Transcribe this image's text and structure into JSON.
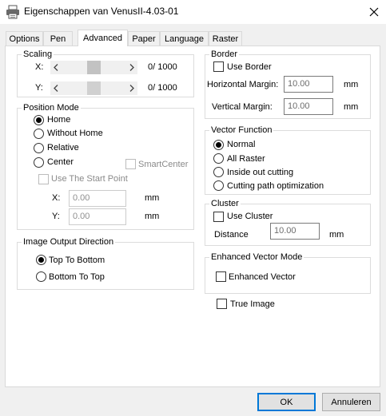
{
  "window": {
    "title": "Eigenschappen van VenusII-4.03-01",
    "icon": "printer-icon",
    "close_icon": "close-icon"
  },
  "tabs": [
    {
      "label": "Options",
      "active": false
    },
    {
      "label": "Pen",
      "active": false
    },
    {
      "label": "Advanced",
      "active": true
    },
    {
      "label": "Paper",
      "active": false
    },
    {
      "label": "Language",
      "active": false
    },
    {
      "label": "Raster",
      "active": false
    }
  ],
  "scaling": {
    "legend": "Scaling",
    "x": {
      "label": "X:",
      "value_text": "0/ 1000",
      "value": 0,
      "max": 1000
    },
    "y": {
      "label": "Y:",
      "value_text": "0/ 1000",
      "value": 0,
      "max": 1000
    }
  },
  "position_mode": {
    "legend": "Position Mode",
    "options": [
      {
        "label": "Home",
        "checked": true
      },
      {
        "label": "Without Home",
        "checked": false
      },
      {
        "label": "Relative",
        "checked": false
      },
      {
        "label": "Center",
        "checked": false
      }
    ],
    "smart_center": {
      "label": "SmartCenter",
      "checked": false,
      "enabled": false
    },
    "use_start_point": {
      "label": "Use The Start Point",
      "checked": false,
      "enabled": false
    },
    "x": {
      "label": "X:",
      "value": "0.00",
      "unit": "mm"
    },
    "y": {
      "label": "Y:",
      "value": "0.00",
      "unit": "mm"
    }
  },
  "image_output_direction": {
    "legend": "Image Output Direction",
    "options": [
      {
        "label": "Top To Bottom",
        "checked": true
      },
      {
        "label": "Bottom To Top",
        "checked": false
      }
    ]
  },
  "border": {
    "legend": "Border",
    "use_border": {
      "label": "Use Border",
      "checked": false
    },
    "horizontal_margin": {
      "label": "Horizontal Margin:",
      "value": "10.00",
      "unit": "mm"
    },
    "vertical_margin": {
      "label": "Vertical Margin:",
      "value": "10.00",
      "unit": "mm"
    }
  },
  "vector_function": {
    "legend": "Vector Function",
    "options": [
      {
        "label": "Normal",
        "checked": true
      },
      {
        "label": "All Raster",
        "checked": false
      },
      {
        "label": "Inside out cutting",
        "checked": false
      },
      {
        "label": "Cutting path optimization",
        "checked": false
      }
    ]
  },
  "cluster": {
    "legend": "Cluster",
    "use_cluster": {
      "label": "Use Cluster",
      "checked": false
    },
    "distance": {
      "label": "Distance",
      "value": "10.00",
      "unit": "mm"
    }
  },
  "enhanced_vector_mode": {
    "legend": "Enhanced Vector Mode",
    "enhanced_vector": {
      "label": "Enhanced Vector",
      "checked": false
    }
  },
  "true_image": {
    "label": "True Image",
    "checked": false
  },
  "buttons": {
    "ok": "OK",
    "cancel": "Annuleren"
  },
  "colors": {
    "accent": "#0078d7"
  }
}
